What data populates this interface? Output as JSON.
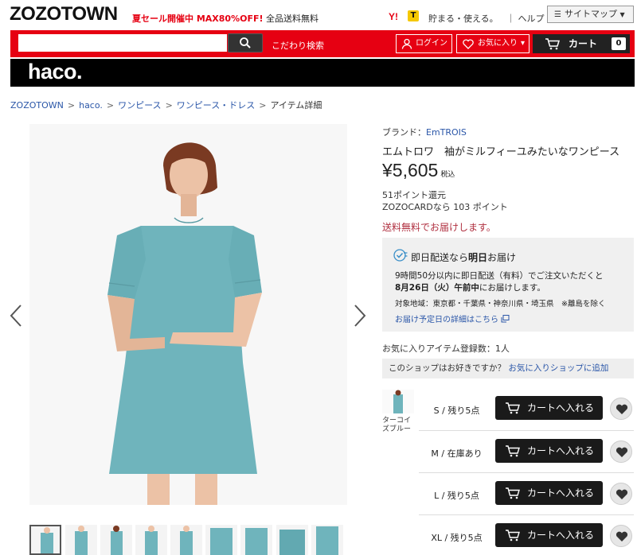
{
  "header": {
    "logo": "ZOZOTOWN",
    "promo_red": "夏セール開催中 MAX80%OFF!",
    "promo_rest": " 全品送料無料",
    "yahoo_icon": "Y!",
    "t_icon": "T",
    "tamaru": "貯まる・使える。",
    "help": "｜ ヘルプ",
    "sitemap": "サイトマップ",
    "sitemap_arrow": "▼"
  },
  "search": {
    "placeholder": "",
    "kodawari": "こだわり検索"
  },
  "nav": {
    "login": "ログイン",
    "favorites": "お気に入り",
    "favorites_arrow": "▾",
    "cart": "カート",
    "cart_count": "0"
  },
  "shop": {
    "logo": "haco."
  },
  "breadcrumb": {
    "items": [
      "ZOZOTOWN",
      "haco.",
      "ワンピース",
      "ワンピース・ドレス"
    ],
    "current": "アイテム詳細",
    "sep": ">"
  },
  "product": {
    "brand_label": "ブランド：",
    "brand": "EmTROIS",
    "name": "エムトロワ　袖がミルフィーユみたいなワンピース",
    "price": "¥5,605",
    "tax": "税込",
    "points_line1": "51ポイント還元",
    "points_line2": "ZOZOCARDなら 103 ポイント",
    "free_shipping": "送料無料でお届けします。"
  },
  "delivery": {
    "title_pre": "即日配送なら",
    "title_bold": "明日",
    "title_post": "お届け",
    "line1": "9時間50分以内に即日配送（有料）でご注文いただくと",
    "line2_bold": "8月26日（火）午前中",
    "line2_rest": "にお届けします。",
    "area": "対象地域：東京都・千葉県・神奈川県・埼玉県　※離島を除く",
    "link": "お届け予定日の詳細はこちら"
  },
  "favorites_count": "お気に入りアイテム登録数：1人",
  "shop_like": {
    "question": "このショップはお好きですか？ ",
    "link": "お気に入りショップに追加"
  },
  "color": {
    "name": "ターコイズブルー"
  },
  "sizes": [
    {
      "label": "S / 残り5点",
      "button": "カートへ入れる"
    },
    {
      "label": "M / 在庫あり",
      "button": "カートへ入れる"
    },
    {
      "label": "L / 残り5点",
      "button": "カートへ入れる"
    },
    {
      "label": "XL / 残り5点",
      "button": "カートへ入れる"
    }
  ],
  "colors": {
    "brand_red": "#e60012",
    "dress": "#6fb4bc",
    "link": "#2a56a8"
  }
}
